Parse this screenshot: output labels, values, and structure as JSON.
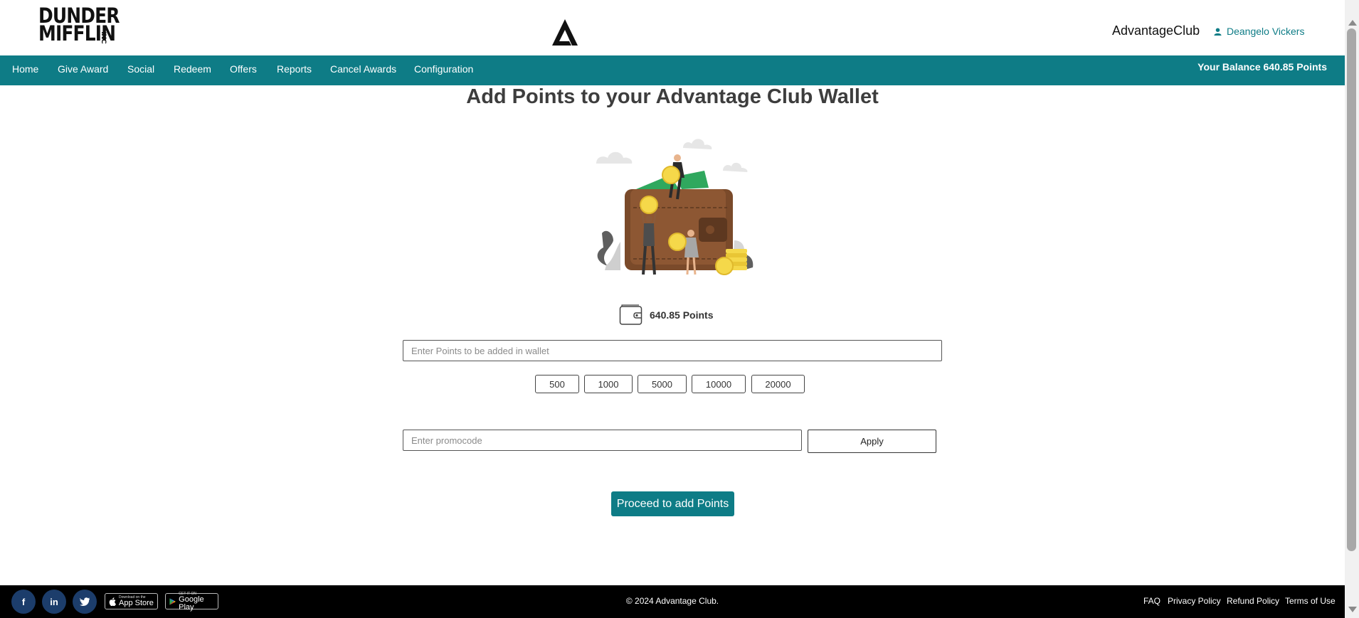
{
  "header": {
    "logo_line1": "DUNDER",
    "logo_line2": "MIFFLIN",
    "logo_inc": "INC",
    "brand_name": "AdvantageClub",
    "user_name": "Deangelo Vickers"
  },
  "nav": {
    "items": [
      {
        "label": "Home"
      },
      {
        "label": "Give Award"
      },
      {
        "label": "Social"
      },
      {
        "label": "Redeem"
      },
      {
        "label": "Offers"
      },
      {
        "label": "Reports"
      },
      {
        "label": "Cancel Awards"
      },
      {
        "label": "Configuration"
      }
    ],
    "balance": "Your Balance 640.85 Points"
  },
  "main": {
    "title": "Add Points to your Advantage Club Wallet",
    "wallet_points": "640.85 Points",
    "points_placeholder": "Enter Points to be added in wallet",
    "quick_amounts": [
      "500",
      "1000",
      "5000",
      "10000",
      "20000"
    ],
    "promo_placeholder": "Enter promocode",
    "apply_label": "Apply",
    "proceed_label": "Proceed to add Points"
  },
  "footer": {
    "social": [
      {
        "icon": "facebook-icon",
        "glyph": "f"
      },
      {
        "icon": "linkedin-icon",
        "glyph": "in"
      },
      {
        "icon": "twitter-icon",
        "glyph": "t"
      }
    ],
    "app_store": {
      "small": "Download on the",
      "big": "App Store"
    },
    "google_play": {
      "small": "GET IT ON",
      "big": "Google Play"
    },
    "copyright": "© 2024 Advantage Club.",
    "links": [
      "FAQ",
      "Privacy Policy",
      "Refund Policy",
      "Terms of Use"
    ]
  },
  "colors": {
    "primary": "#0e7c86",
    "footer_bg": "#000000",
    "title": "#3d3d3d"
  }
}
